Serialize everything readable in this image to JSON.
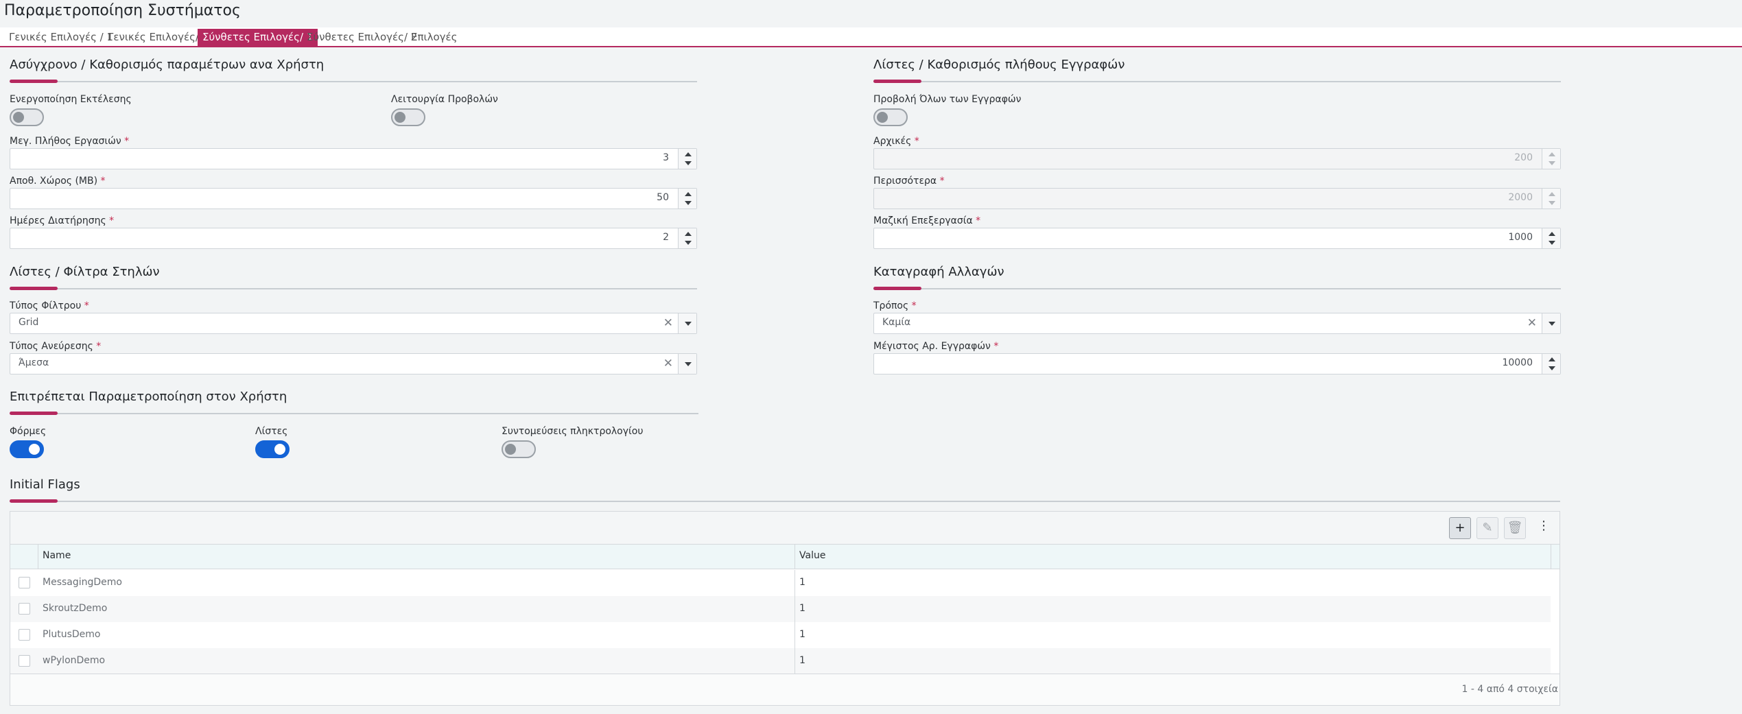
{
  "page": {
    "title": "Παραμετροποίηση Συστήματος"
  },
  "tabs": [
    {
      "label": "Γενικές Επιλογές / 1",
      "active": false
    },
    {
      "label": "Γενικές Επιλογές/ 2",
      "active": false
    },
    {
      "label": "Σύνθετες Επιλογές/ 1",
      "active": true
    },
    {
      "label": "Σύνθετες Επιλογές/ 2",
      "active": false
    },
    {
      "label": "Επιλογές",
      "active": false
    }
  ],
  "colors": {
    "accent": "#b5295f",
    "toggle_on": "#1463d6"
  },
  "async": {
    "title": "Ασύγχρονο / Καθορισμός παραμέτρων ανα Χρήστη",
    "execution_label": "Ενεργοποίηση Εκτέλεσης",
    "execution_on": false,
    "views_label": "Λειτουργία Προβολών",
    "views_on": false,
    "max_jobs_label": "Μεγ. Πλήθος Εργασιών",
    "max_jobs": "3",
    "storage_label": "Αποθ. Χώρος (MB)",
    "storage": "50",
    "retention_label": "Ημέρες Διατήρησης",
    "retention": "2",
    "required_mark": "*"
  },
  "lists_records": {
    "title": "Λίστες / Καθορισμός πλήθους Εγγραφών",
    "show_all_label": "Προβολή Όλων των Εγγραφών",
    "show_all_on": false,
    "initial_label": "Αρχικές",
    "initial": "200",
    "more_label": "Περισσότερα",
    "more": "2000",
    "batch_label": "Μαζική Επεξεργασία",
    "batch": "1000"
  },
  "column_filters": {
    "title": "Λίστες / Φίλτρα Στηλών",
    "filter_type_label": "Τύπος Φίλτρου",
    "filter_type": "Grid",
    "search_type_label": "Τύπος Ανεύρεσης",
    "search_type": "Άμεσα"
  },
  "change_log": {
    "title": "Καταγραφή Αλλαγών",
    "mode_label": "Τρόπος",
    "mode": "Καμία",
    "max_records_label": "Μέγιστος Αρ. Εγγραφών",
    "max_records": "10000"
  },
  "user_custom": {
    "title": "Επιτρέπεται Παραμετροποίηση στον Χρήστη",
    "forms_label": "Φόρμες",
    "forms_on": true,
    "lists_label": "Λίστες",
    "lists_on": true,
    "shortcuts_label": "Συντομεύσεις πληκτρολογίου",
    "shortcuts_on": false
  },
  "flags": {
    "title": "Initial Flags",
    "toolbar": {
      "add_icon": "plus-icon",
      "edit_icon": "pencil-icon",
      "delete_icon": "trash-icon",
      "more_icon": "kebab-icon"
    },
    "columns": [
      "Name",
      "Value"
    ],
    "rows": [
      {
        "name": "MessagingDemo",
        "value": "1"
      },
      {
        "name": "SkroutzDemo",
        "value": "1"
      },
      {
        "name": "PlutusDemo",
        "value": "1"
      },
      {
        "name": "wPylonDemo",
        "value": "1"
      }
    ],
    "footer": "1 - 4 από 4 στοιχεία"
  }
}
